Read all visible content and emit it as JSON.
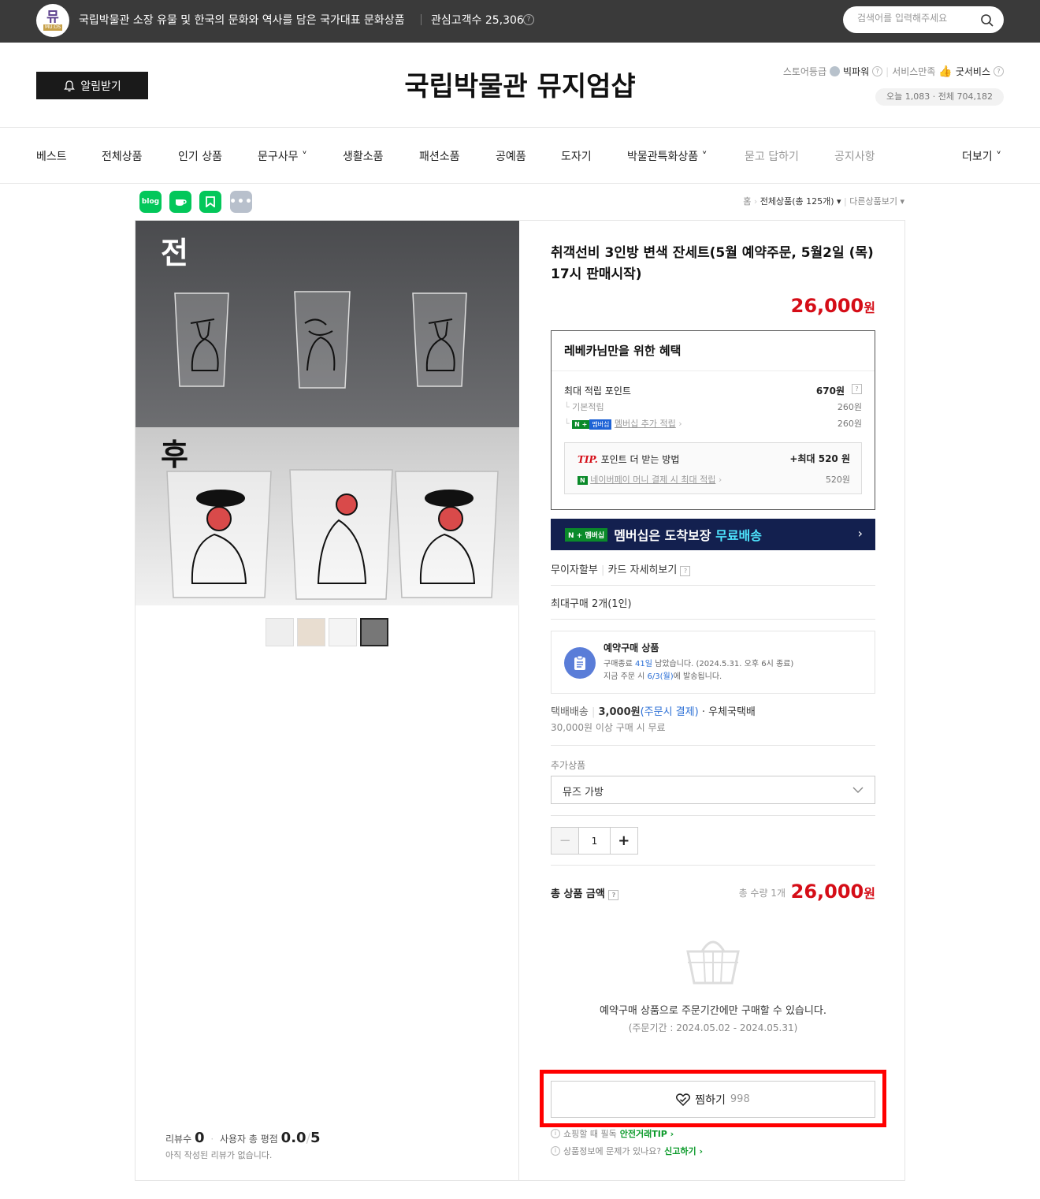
{
  "topbar": {
    "logo_text": "뮤",
    "logo_sub": "MU:DS",
    "tagline": "국립박물관 소장 유물 및 한국의 문화와 역사를 담은 국가대표 문화상품",
    "fans": "관심고객수 25,306",
    "search_placeholder": "검색어를 입력해주세요"
  },
  "header": {
    "alarm_label": "알림받기",
    "store_title": "국립박물관 뮤지엄샵",
    "grade_label": "스토어등급",
    "grade_value": "빅파워",
    "service_label": "서비스만족",
    "service_value": "굿서비스",
    "visit": "오늘 1,083 · 전체 704,182"
  },
  "nav": [
    "베스트",
    "전체상품",
    "인기 상품",
    "문구사무 ˅",
    "생활소품",
    "패션소품",
    "공예품",
    "도자기",
    "박물관특화상품 ˅",
    "묻고 답하기",
    "공지사항",
    "더보기 ˅"
  ],
  "share": [
    "blog",
    "cafe",
    "keep",
    "more"
  ],
  "breadcrumb": {
    "home": "홈",
    "current": "전체상품(총 125개) ▾",
    "other": "다른상품보기 ▾"
  },
  "gallery": {
    "before_label": "전",
    "after_label": "후"
  },
  "review": {
    "count_label": "리뷰수",
    "count": "0",
    "rating_label": "사용자 총 평점",
    "rating": "0.0",
    "rating_max": "5",
    "empty": "아직 작성된 리뷰가 없습니다."
  },
  "product": {
    "title": "취객선비 3인방 변색 잔세트(5월 예약주문, 5월2일 (목) 17시 판매시작)",
    "price": "26,000",
    "won": "원"
  },
  "benefit": {
    "head": "레베카님만을 위한 혜택",
    "max_point_label": "최대 적립 포인트",
    "max_point": "670원",
    "base_label": "기본적립",
    "base": "260원",
    "member_badge_n": "N +",
    "member_badge": "멤버십",
    "member_label": "멤버십 추가 적립",
    "member": "260원",
    "tip": "TIP.",
    "tip_label": "포인트 더 받는 방법",
    "tip_max": "+최대 520 원",
    "npay_badge": "N",
    "npay_label": "네이버페이 머니 결제 시 최대 적립",
    "npay": "520원"
  },
  "banner": {
    "badge": "N + 멤버십",
    "text": "멤버십은 도착보장",
    "highlight": "무료배송",
    "arrow": "›"
  },
  "payment": {
    "installment": "무이자할부",
    "card": "카드 자세히보기"
  },
  "max_buy": "최대구매 2개(1인)",
  "reserve": {
    "title": "예약구매 상품",
    "line1_a": "구매종료",
    "line1_b": "41일",
    "line1_c": "남았습니다. (2024.5.31. 오후 6시 종료)",
    "line2_a": "지금 주문 시",
    "line2_b": "6/3(월)",
    "line2_c": "에 발송됩니다."
  },
  "shipping": {
    "label": "택배배송",
    "fee": "3,000원",
    "fee_note": "(주문시 결제)",
    "carrier": "· 우체국택배",
    "free": "30,000원 이상 구매 시 무료"
  },
  "addon": {
    "label": "추가상품",
    "selected": "뮤즈 가방"
  },
  "quantity": {
    "minus": "−",
    "value": "1",
    "plus": "+"
  },
  "total": {
    "label": "총 상품 금액",
    "count": "총 수량 1개",
    "price": "26,000",
    "won": "원"
  },
  "notice": {
    "line1": "예약구매 상품으로 주문기간에만 구매할 수 있습니다.",
    "line2": "(주문기간 : 2024.05.02 - 2024.05.31)"
  },
  "wish": {
    "label": "찜하기",
    "count": "998"
  },
  "footer": {
    "tip_text": "쇼핑할 때 필독",
    "tip_link": "안전거래TIP ›",
    "report_text": "상품정보에 문제가 있나요?",
    "report_link": "신고하기 ›"
  },
  "colors": {
    "price_red": "#d50d17",
    "banner_navy": "#13204f",
    "highlight_frame": "#ff0000",
    "naver_green": "#0b9a2a"
  }
}
